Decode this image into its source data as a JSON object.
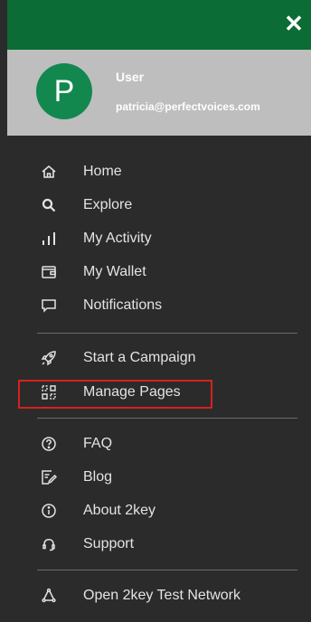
{
  "header": {
    "close_label": "✕"
  },
  "profile": {
    "initial": "P",
    "name": "User",
    "email": "patricia@perfectvoices.com"
  },
  "menu": {
    "group1": [
      {
        "label": "Home",
        "icon": "home-icon"
      },
      {
        "label": "Explore",
        "icon": "search-icon"
      },
      {
        "label": "My Activity",
        "icon": "bar-chart-icon"
      },
      {
        "label": "My Wallet",
        "icon": "wallet-icon"
      },
      {
        "label": "Notifications",
        "icon": "chat-bubble-icon"
      }
    ],
    "group2": [
      {
        "label": "Start a Campaign",
        "icon": "rocket-icon"
      },
      {
        "label": "Manage Pages",
        "icon": "manage-pages-icon"
      }
    ],
    "group3": [
      {
        "label": "FAQ",
        "icon": "question-circle-icon"
      },
      {
        "label": "Blog",
        "icon": "edit-note-icon"
      },
      {
        "label": "About 2key",
        "icon": "info-circle-icon"
      },
      {
        "label": "Support",
        "icon": "headset-icon"
      }
    ],
    "group4": [
      {
        "label": "Open 2key Test Network",
        "icon": "network-icon"
      }
    ]
  },
  "colors": {
    "header_green": "#0b6c35",
    "avatar_green": "#12884f",
    "highlight_red": "#d92020"
  }
}
